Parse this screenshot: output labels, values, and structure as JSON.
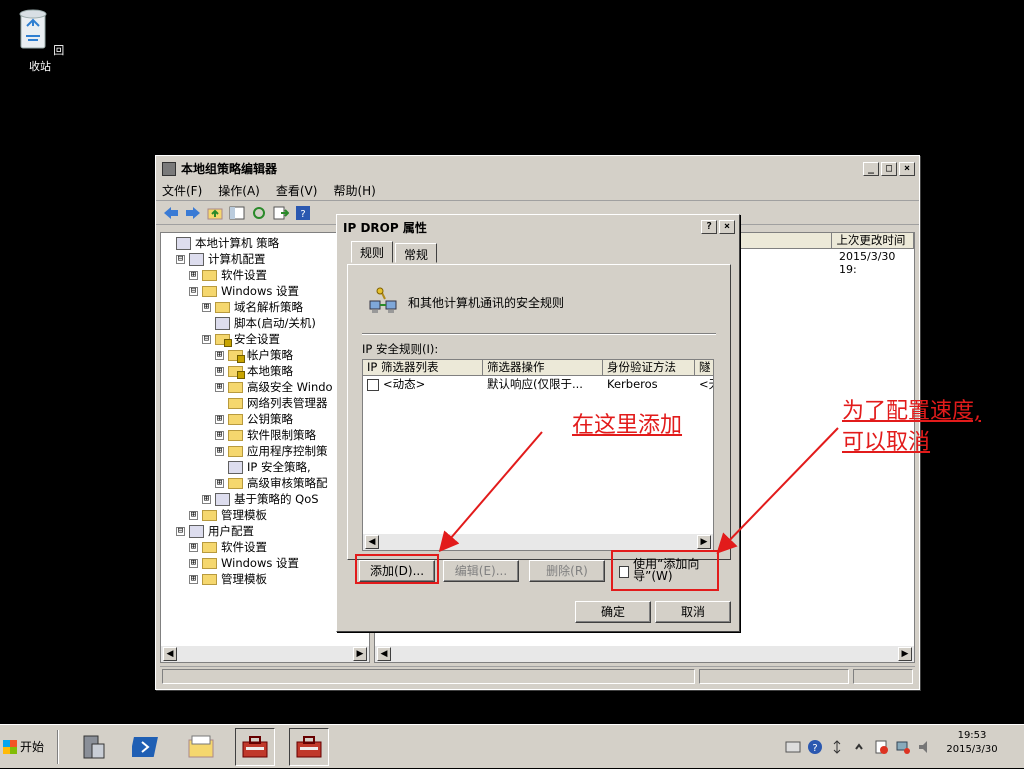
{
  "desktop": {
    "recycle_bin_label": "回收站"
  },
  "main_window": {
    "title": "本地组策略编辑器",
    "controls": [
      "_",
      "□",
      "×"
    ],
    "menu": [
      "文件(F)",
      "操作(A)",
      "查看(V)",
      "帮助(H)"
    ],
    "tree": [
      {
        "label": "本地计算机 策略",
        "indent": 0,
        "exp": "",
        "icon": "node"
      },
      {
        "label": "计算机配置",
        "indent": 1,
        "exp": "⊟",
        "icon": "node"
      },
      {
        "label": "软件设置",
        "indent": 2,
        "exp": "⊞",
        "icon": "folder"
      },
      {
        "label": "Windows 设置",
        "indent": 2,
        "exp": "⊟",
        "icon": "folder"
      },
      {
        "label": "域名解析策略",
        "indent": 3,
        "exp": "⊞",
        "icon": "folder"
      },
      {
        "label": "脚本(启动/关机)",
        "indent": 3,
        "exp": "",
        "icon": "node"
      },
      {
        "label": "安全设置",
        "indent": 3,
        "exp": "⊟",
        "icon": "folder-lock"
      },
      {
        "label": "帐户策略",
        "indent": 4,
        "exp": "⊞",
        "icon": "folder-lock"
      },
      {
        "label": "本地策略",
        "indent": 4,
        "exp": "⊞",
        "icon": "folder-lock"
      },
      {
        "label": "高级安全 Windo",
        "indent": 4,
        "exp": "⊞",
        "icon": "folder"
      },
      {
        "label": "网络列表管理器",
        "indent": 4,
        "exp": "",
        "icon": "folder"
      },
      {
        "label": "公钥策略",
        "indent": 4,
        "exp": "⊞",
        "icon": "folder"
      },
      {
        "label": "软件限制策略",
        "indent": 4,
        "exp": "⊞",
        "icon": "folder"
      },
      {
        "label": "应用程序控制策",
        "indent": 4,
        "exp": "⊞",
        "icon": "folder"
      },
      {
        "label": "IP 安全策略,",
        "indent": 4,
        "exp": "",
        "icon": "node"
      },
      {
        "label": "高级审核策略配",
        "indent": 4,
        "exp": "⊞",
        "icon": "folder"
      },
      {
        "label": "基于策略的 QoS",
        "indent": 3,
        "exp": "⊞",
        "icon": "node"
      },
      {
        "label": "管理模板",
        "indent": 2,
        "exp": "⊞",
        "icon": "folder"
      },
      {
        "label": "用户配置",
        "indent": 1,
        "exp": "⊟",
        "icon": "node"
      },
      {
        "label": "软件设置",
        "indent": 2,
        "exp": "⊞",
        "icon": "folder"
      },
      {
        "label": "Windows 设置",
        "indent": 2,
        "exp": "⊞",
        "icon": "folder"
      },
      {
        "label": "管理模板",
        "indent": 2,
        "exp": "⊞",
        "icon": "folder"
      }
    ],
    "list_header_last_changed": "上次更改时间",
    "list_row_date": "2015/3/30 19:"
  },
  "dialog": {
    "title": "IP DROP 属性",
    "help_btn": "?",
    "close_btn": "×",
    "tabs": [
      "规则",
      "常规"
    ],
    "header_text": "和其他计算机通讯的安全规则",
    "list_label": "IP 安全规则(I):",
    "columns": [
      "IP 筛选器列表",
      "筛选器操作",
      "身份验证方法",
      "隧"
    ],
    "rows": [
      {
        "filter": "<动态>",
        "action": "默认响应(仅限于...",
        "auth": "Kerberos",
        "tunnel": "<无"
      }
    ],
    "add_button": "添加(D)...",
    "edit_button": "编辑(E)...",
    "delete_button": "删除(R)",
    "wizard_label": "使用“添加向导”(W)",
    "ok_button": "确定",
    "cancel_button": "取消"
  },
  "annotations": {
    "add_here": "在这里添加",
    "config_speed_line1": "为了配置速度,",
    "config_speed_line2": "可以取消",
    "color": "#e21b1b"
  },
  "taskbar": {
    "start_label": "开始",
    "clock_time": "19:53",
    "clock_date": "2015/3/30"
  }
}
